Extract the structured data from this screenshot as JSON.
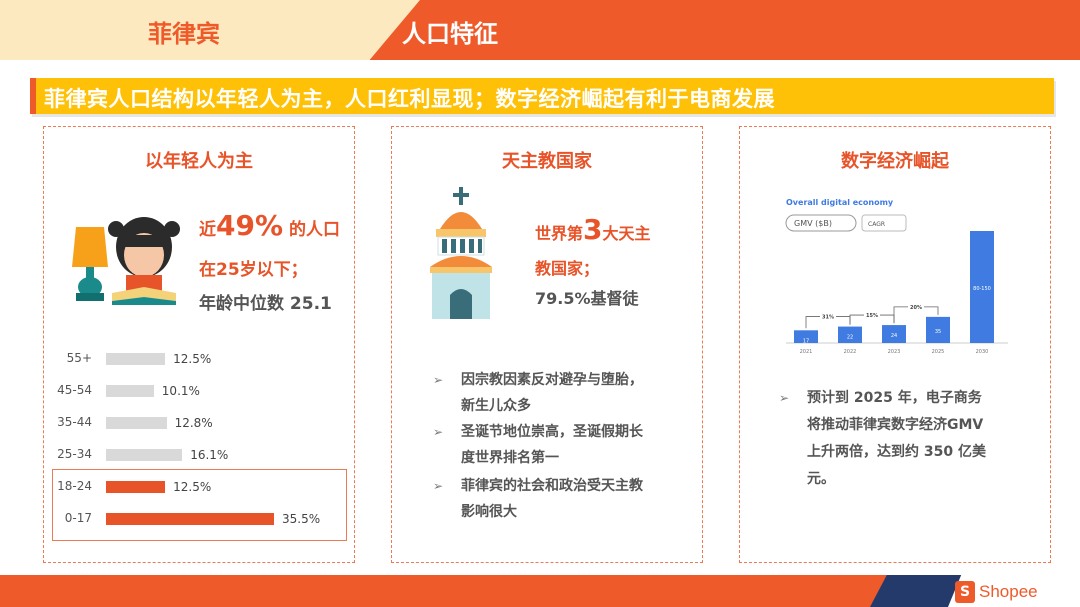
{
  "header": {
    "country": "菲律宾",
    "title": "人口特征"
  },
  "headline": "菲律宾人口结构以年轻人为主，人口红利显现；数字经济崛起有利于电商发展",
  "card1": {
    "title": "以年轻人为主",
    "stat_prefix": "近",
    "stat_number": "49%",
    "stat_suffix": " 的人口",
    "line2": "在25岁以下；",
    "line3": "年龄中位数 25.1",
    "age_chart": {
      "type": "bar",
      "categories": [
        "55+",
        "45-54",
        "35-44",
        "25-34",
        "18-24",
        "0-17"
      ],
      "values": [
        12.5,
        10.1,
        12.8,
        16.1,
        12.5,
        35.5
      ],
      "value_labels": [
        "12.5%",
        "10.1%",
        "12.8%",
        "16.1%",
        "12.5%",
        "35.5%"
      ],
      "highlighted": [
        "18-24",
        "0-17"
      ],
      "colors": {
        "normal": "#d9d9d9",
        "highlight": "#e8542a"
      }
    }
  },
  "card2": {
    "title": "天主教国家",
    "stat_prefix": "世界第",
    "stat_number": "3",
    "stat_suffix": "大天主",
    "line2": "教国家；",
    "line3": "79.5%基督徒",
    "bullets": [
      [
        "因宗教因素反对避孕与堕胎，",
        "新生儿众多"
      ],
      [
        "圣诞节地位崇高，圣诞假期长",
        "度世界排名第一"
      ],
      [
        "菲律宾的社会和政治受天主教",
        "影响很大"
      ]
    ]
  },
  "card3": {
    "title": "数字经济崛起",
    "chart": {
      "type": "bar",
      "title": "Overall digital economy",
      "pill_gmv": "GMV ($B)",
      "pill_cagr": "CAGR",
      "categories": [
        "2021",
        "2022",
        "2023",
        "2025",
        "2030"
      ],
      "values": [
        17,
        22,
        24,
        35,
        150
      ],
      "value_labels": [
        "17",
        "22",
        "24",
        "35",
        "80-150"
      ],
      "growth_labels": [
        "31%",
        "15%",
        "20%"
      ],
      "color": "#3f7be0"
    },
    "bullet": [
      "预计到 2025 年，电子商务",
      "将推动菲律宾数字经济GMV",
      "上升两倍，达到约 350 亿美",
      "元。"
    ]
  },
  "footer": {
    "brand": "Shopee",
    "brand_icon": "S",
    "colors": {
      "orange": "#ee5a2a",
      "navy": "#243a6b"
    }
  }
}
